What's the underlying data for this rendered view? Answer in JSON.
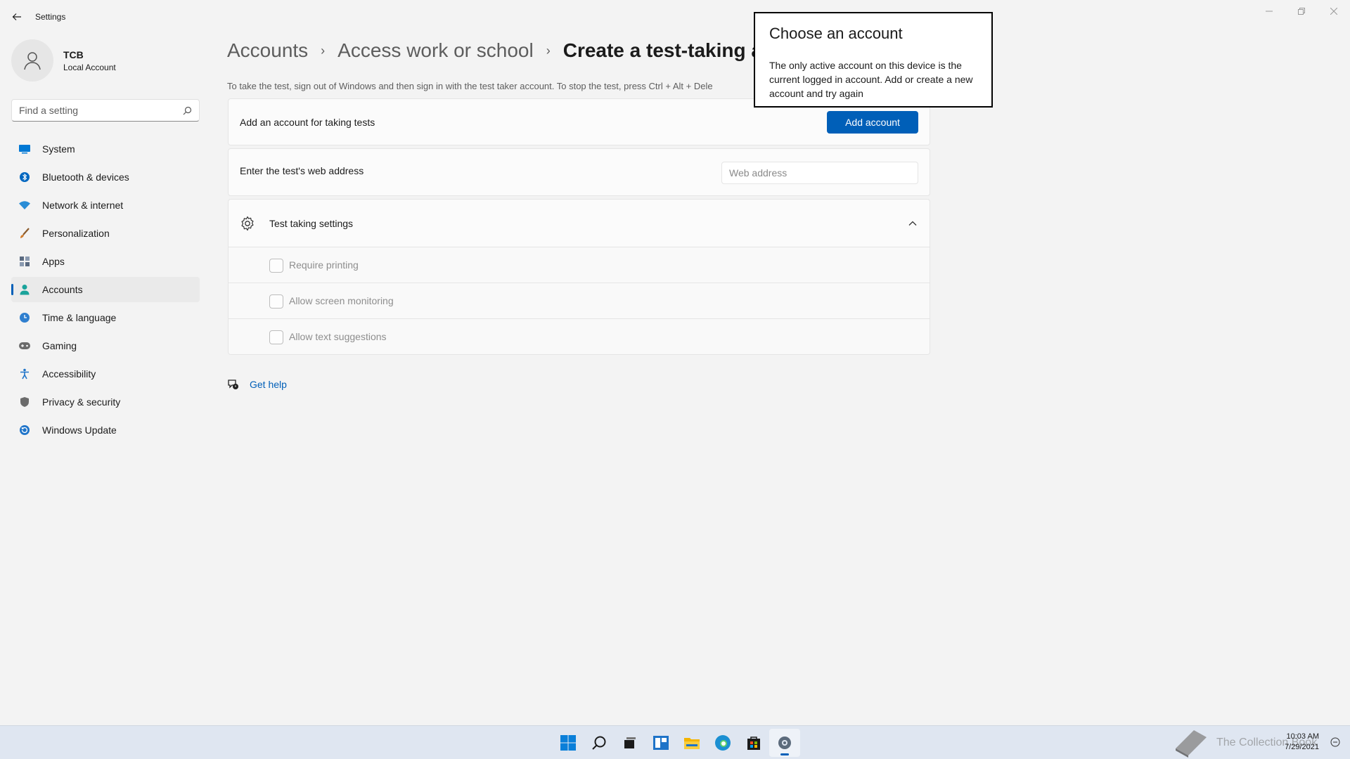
{
  "window": {
    "title": "Settings",
    "controls": [
      "minimize",
      "restore",
      "close"
    ]
  },
  "profile": {
    "name": "TCB",
    "account_type": "Local Account"
  },
  "search": {
    "placeholder": "Find a setting"
  },
  "sidebar": {
    "items": [
      {
        "label": "System",
        "icon": "system-icon",
        "color": "#0078d4"
      },
      {
        "label": "Bluetooth & devices",
        "icon": "bluetooth-icon",
        "color": "#0067c0"
      },
      {
        "label": "Network & internet",
        "icon": "wifi-icon",
        "color": "#2a8dd6"
      },
      {
        "label": "Personalization",
        "icon": "brush-icon",
        "color": "#d17b2c"
      },
      {
        "label": "Apps",
        "icon": "apps-icon",
        "color": "#5a6a80"
      },
      {
        "label": "Accounts",
        "icon": "person-icon",
        "color": "#1aa39b",
        "active": true
      },
      {
        "label": "Time & language",
        "icon": "globe-clock-icon",
        "color": "#2f7fcf"
      },
      {
        "label": "Gaming",
        "icon": "gamepad-icon",
        "color": "#6b6b6b"
      },
      {
        "label": "Accessibility",
        "icon": "accessibility-icon",
        "color": "#1f74c9"
      },
      {
        "label": "Privacy & security",
        "icon": "shield-icon",
        "color": "#6b6b6b"
      },
      {
        "label": "Windows Update",
        "icon": "update-icon",
        "color": "#1f74c9"
      }
    ]
  },
  "breadcrumb": {
    "items": [
      "Accounts",
      "Access work or school",
      "Create a test-taking a"
    ]
  },
  "description": "To take the test, sign out of Windows and then sign in with the test taker account. To stop the test, press Ctrl + Alt + Dele",
  "add_account_card": {
    "label": "Add an account for taking tests",
    "button": "Add account"
  },
  "web_address_card": {
    "label": "Enter the test's web address",
    "placeholder": "Web address"
  },
  "test_settings": {
    "title": "Test taking settings",
    "expanded": true,
    "options": [
      {
        "label": "Require printing",
        "checked": false
      },
      {
        "label": "Allow screen monitoring",
        "checked": false
      },
      {
        "label": "Allow text suggestions",
        "checked": false
      }
    ]
  },
  "help": {
    "label": "Get help"
  },
  "dialog": {
    "title": "Choose an account",
    "message": "The only active account on this device is the current logged in account. Add or create a new account and try again"
  },
  "taskbar": {
    "apps": [
      "start-icon",
      "search-icon",
      "task-view-icon",
      "widgets-icon",
      "file-explorer-icon",
      "edge-icon",
      "store-icon",
      "settings-icon"
    ],
    "active_app": "settings-icon",
    "watermark": "The Collection Book",
    "time": "10:03 AM",
    "date": "7/29/2021"
  },
  "colors": {
    "accent": "#005fb8",
    "background": "#f3f3f3",
    "card": "#fbfbfb"
  }
}
